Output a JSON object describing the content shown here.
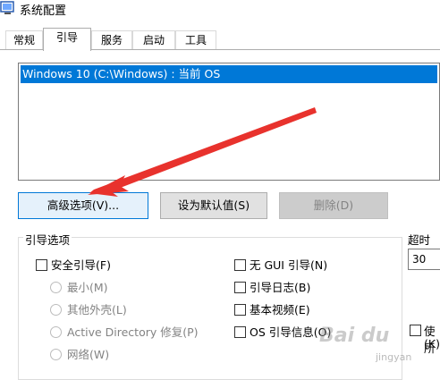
{
  "window": {
    "title": "系统配置"
  },
  "tabs": [
    {
      "label": "常规"
    },
    {
      "label": "引导"
    },
    {
      "label": "服务"
    },
    {
      "label": "启动"
    },
    {
      "label": "工具"
    }
  ],
  "os_list": {
    "items": [
      "Windows 10 (C:\\Windows) : 当前 OS"
    ]
  },
  "buttons": {
    "advanced": "高级选项(V)...",
    "set_default": "设为默认值(S)",
    "delete": "删除(D)"
  },
  "boot_options": {
    "label": "引导选项",
    "safe_boot": "安全引导(F)",
    "minimal": "最小(M)",
    "alternate_shell": "其他外壳(L)",
    "active_directory": "Active Directory 修复(P)",
    "network": "网络(W)",
    "no_gui": "无 GUI 引导(N)",
    "boot_log": "引导日志(B)",
    "base_video": "基本视频(E)",
    "os_boot_info": "OS 引导信息(O)"
  },
  "timeout": {
    "label": "超时(T",
    "value": "30"
  },
  "make_permanent": {
    "line1": "使所",
    "line2": "(K)"
  },
  "watermark": {
    "brand": "Bai du",
    "sub": "jingyan"
  },
  "colors": {
    "selection": "#0078d7",
    "arrow": "#e8322d",
    "focus_border": "#0078d7"
  }
}
